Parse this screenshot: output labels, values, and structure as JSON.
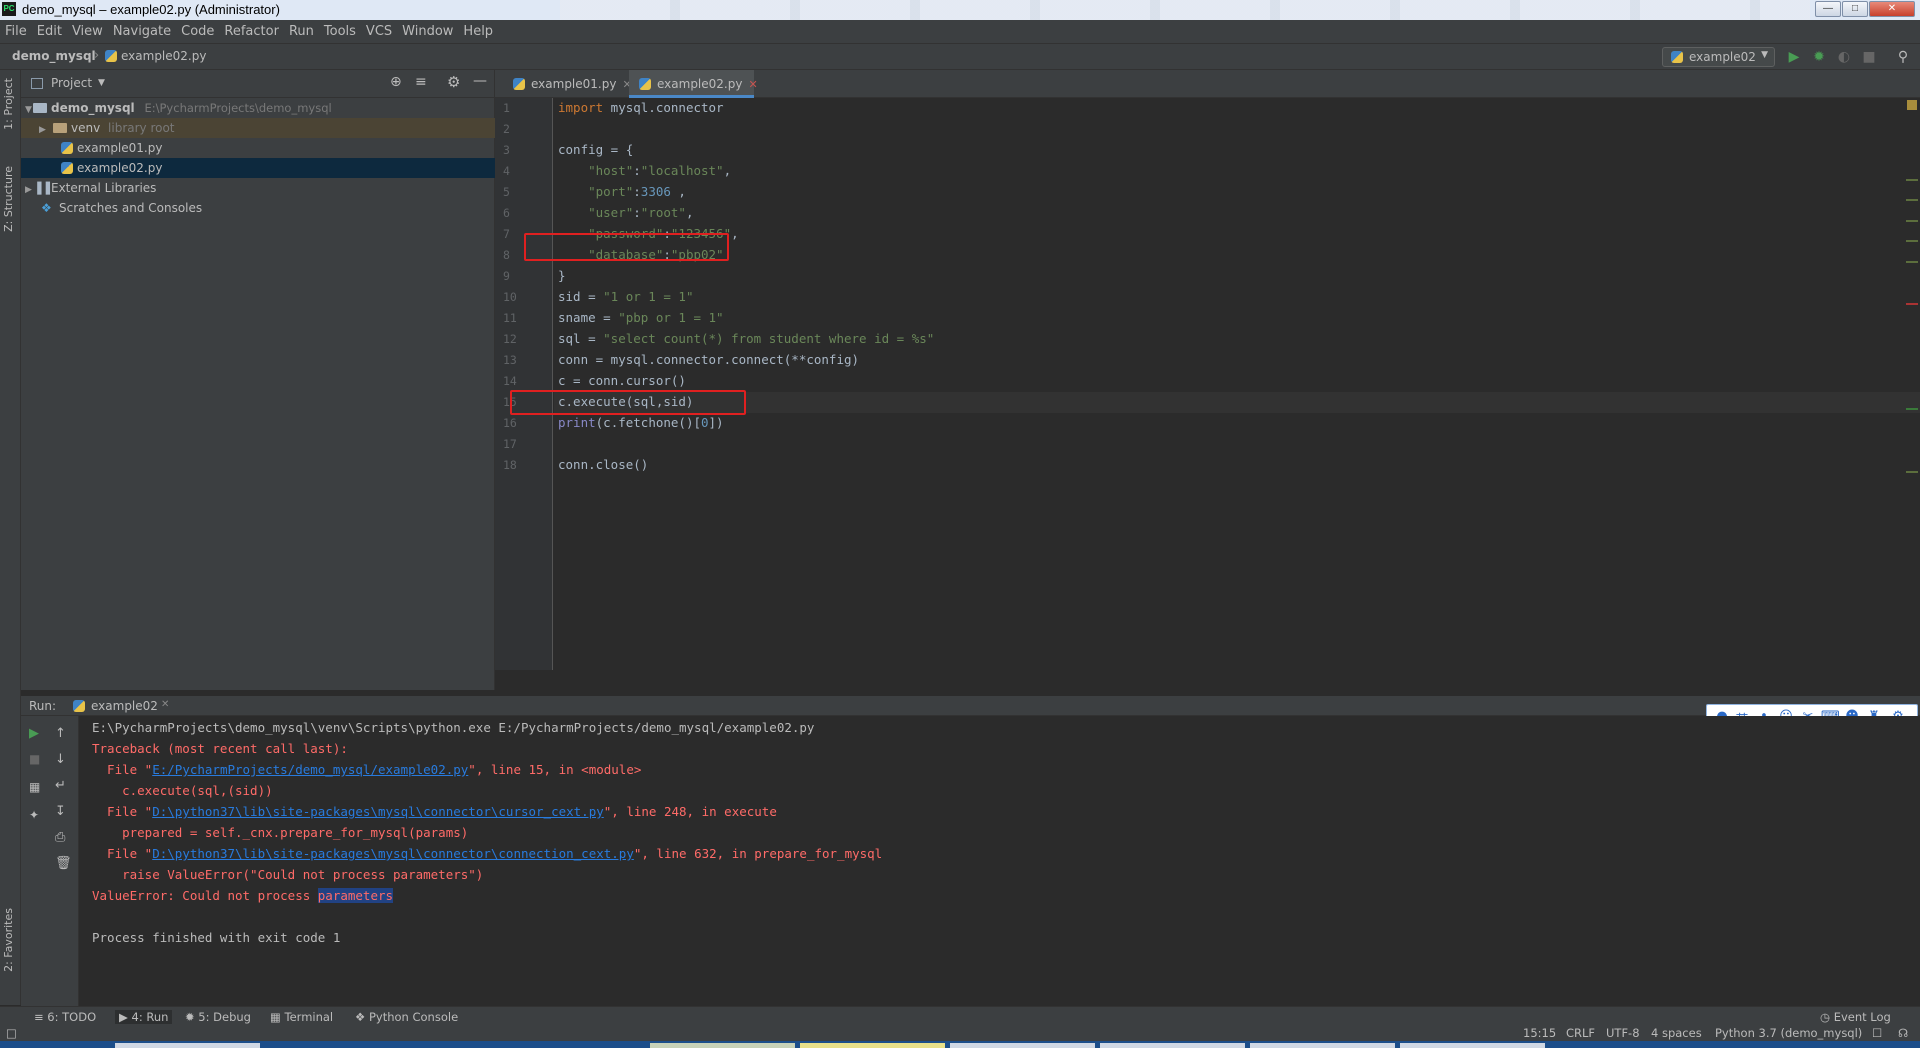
{
  "window": {
    "title": "demo_mysql – example02.py (Administrator)",
    "app_icon": "PC"
  },
  "menu": [
    "File",
    "Edit",
    "View",
    "Navigate",
    "Code",
    "Refactor",
    "Run",
    "Tools",
    "VCS",
    "Window",
    "Help"
  ],
  "breadcrumb": {
    "project": "demo_mysql",
    "file": "example02.py"
  },
  "run_config": "example02",
  "sidebar_tabs": {
    "project": "1: Project",
    "structure": "Z: Structure",
    "favorites": "2: Favorites"
  },
  "project_panel": {
    "title": "Project",
    "tree": [
      {
        "label": "demo_mysql",
        "path": "E:\\PycharmProjects\\demo_mysql"
      },
      {
        "label": "venv",
        "note": "library root"
      },
      {
        "label": "example01.py"
      },
      {
        "label": "example02.py"
      },
      {
        "label": "External Libraries"
      },
      {
        "label": "Scratches and Consoles"
      }
    ]
  },
  "editor_tabs": [
    {
      "label": "example01.py",
      "active": false
    },
    {
      "label": "example02.py",
      "active": true
    }
  ],
  "editor": {
    "current_line": 15,
    "highlighted_lines": [
      10,
      15
    ],
    "lines": [
      "import mysql.connector",
      "",
      "config = {",
      "    \"host\":\"localhost\",",
      "    \"port\":3306 ,",
      "    \"user\":\"root\",",
      "    \"password\":\"123456\",",
      "    \"database\":\"pbp02\"",
      "}",
      "sid = \"1 or 1 = 1\"",
      "sname = \"pbp or 1 = 1\"",
      "sql = \"select count(*) from student where id = %s\"",
      "conn = mysql.connector.connect(**config)",
      "c = conn.cursor()",
      "c.execute(sql,sid)",
      "print(c.fetchone()[0])",
      "",
      "conn.close()"
    ]
  },
  "run_panel": {
    "label": "Run:",
    "tab": "example02",
    "output": [
      {
        "text": "E:\\PycharmProjects\\demo_mysql\\venv\\Scripts\\python.exe E:/PycharmProjects/demo_mysql/example02.py"
      },
      {
        "text": "Traceback (most recent call last):"
      },
      {
        "prefix": "  File \"",
        "link": "E:/PycharmProjects/demo_mysql/example02.py",
        "suffix": "\", line 15, in <module>"
      },
      {
        "text": "    c.execute(sql,(sid))"
      },
      {
        "prefix": "  File \"",
        "link": "D:\\python37\\lib\\site-packages\\mysql\\connector\\cursor_cext.py",
        "suffix": "\", line 248, in execute"
      },
      {
        "text": "    prepared = self._cnx.prepare_for_mysql(params)"
      },
      {
        "prefix": "  File \"",
        "link": "D:\\python37\\lib\\site-packages\\mysql\\connector\\connection_cext.py",
        "suffix": "\", line 632, in prepare_for_mysql"
      },
      {
        "text": "    raise ValueError(\"Could not process parameters\")"
      },
      {
        "prefix": "ValueError: Could not process ",
        "selected": "parameters"
      },
      {
        "text": ""
      },
      {
        "text": "Process finished with exit code 1"
      }
    ]
  },
  "bottom_tools": [
    "6: TODO",
    "4: Run",
    "5: Debug",
    "Terminal",
    "Python Console"
  ],
  "event_log": "Event Log",
  "status": {
    "position": "15:15",
    "line_sep": "CRLF",
    "encoding": "UTF-8",
    "indent": "4 spaces",
    "interpreter": "Python 3.7 (demo_mysql)"
  },
  "ime_toolbar": {
    "mode": "英"
  },
  "colors": {
    "accent": "#4a88c7",
    "error": "#ff6b68",
    "link": "#287bde",
    "highlight_box": "#e02020"
  }
}
